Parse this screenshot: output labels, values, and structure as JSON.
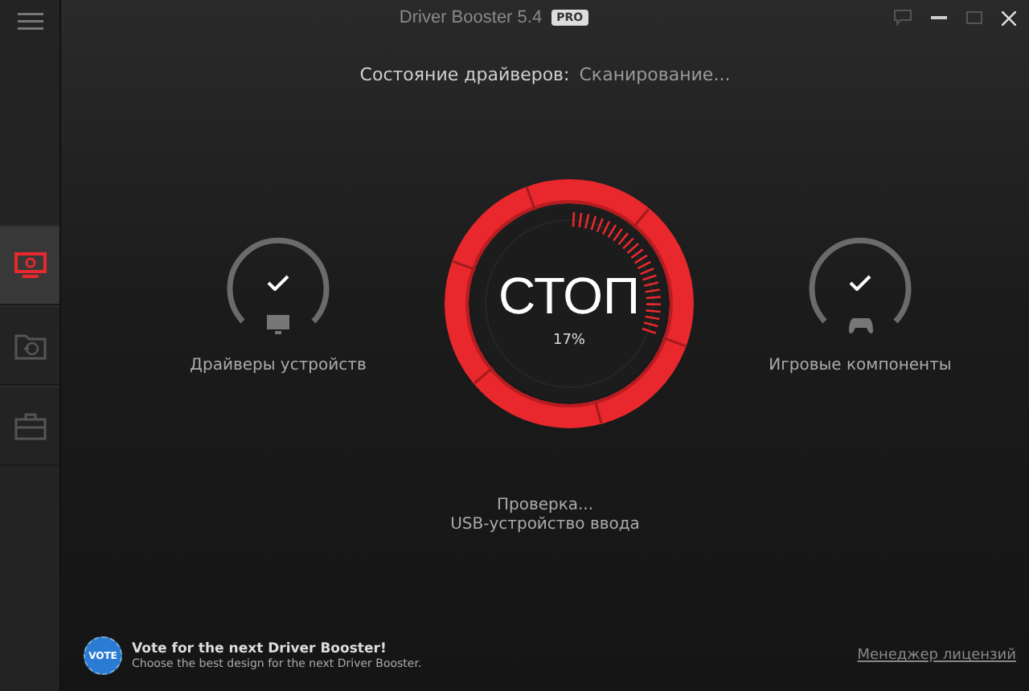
{
  "window": {
    "title": "Driver Booster 5.4",
    "badge": "PRO"
  },
  "sidebar": {
    "items": [
      {
        "kind": "monitor",
        "selected": true
      },
      {
        "kind": "restore",
        "selected": false
      },
      {
        "kind": "toolbox",
        "selected": false
      }
    ]
  },
  "status": {
    "label": "Состояние драйверов:",
    "value": "Сканирование..."
  },
  "gauges": [
    {
      "kind": "monitor",
      "label": "Драйверы устройств",
      "checked": true
    },
    {
      "kind": "gamepad",
      "label": "Игровые компоненты",
      "checked": true
    }
  ],
  "scan_button": {
    "label": "СТОП",
    "percent": "17%"
  },
  "progress": {
    "line_1": "Проверка...",
    "line_2": "USB-устройство ввода"
  },
  "footer": {
    "badge": "VOTE",
    "title": "Vote for the next Driver Booster!",
    "subtitle": "Choose the best design for the next Driver Booster.",
    "link": "Менеджер лицензий"
  }
}
